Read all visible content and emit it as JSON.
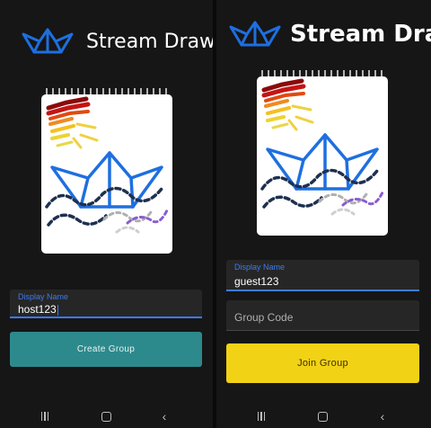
{
  "colors": {
    "background": "#161616",
    "accent": "#3d7bf0",
    "create_button": "#2d8a8c",
    "join_button": "#f2d215",
    "logo": "#1e6fe0"
  },
  "icons": {
    "logo": "paper-boat-icon",
    "nav_recents": "recents-icon",
    "nav_home": "home-icon",
    "nav_back": "back-icon"
  },
  "host_screen": {
    "app_title": "Stream Draw",
    "display_name_label": "Display Name",
    "display_name_value": "host123",
    "create_button_label": "Create Group"
  },
  "guest_screen": {
    "app_title": "Stream Draw",
    "display_name_label": "Display Name",
    "display_name_value": "guest123",
    "group_code_placeholder": "Group Code",
    "join_button_label": "Join Group"
  }
}
